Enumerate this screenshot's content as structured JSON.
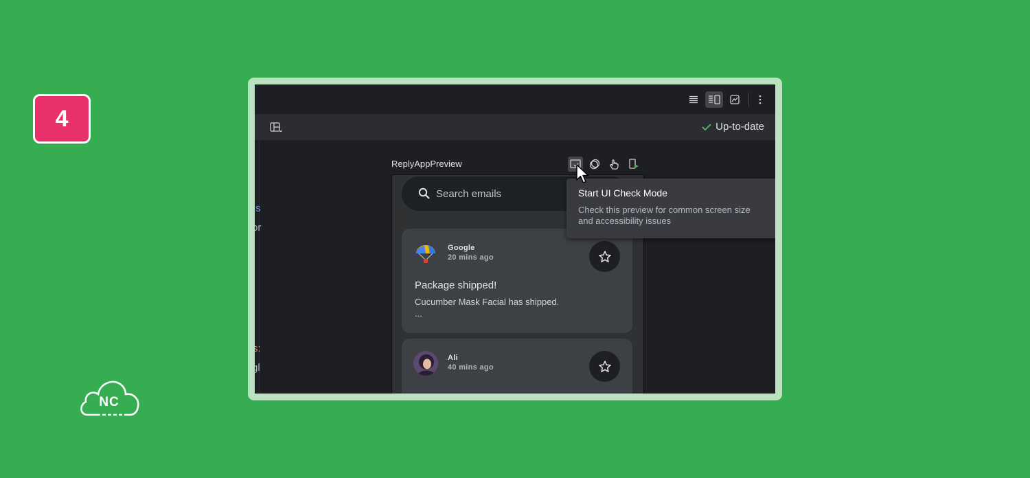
{
  "step": {
    "number": "4"
  },
  "brand": {
    "logo_text": "NC"
  },
  "toolbar": {
    "icons": [
      "code-view-icon",
      "split-view-icon",
      "design-view-icon",
      "more-vertical-icon"
    ]
  },
  "status": {
    "text": "Up-to-date",
    "color": "#59a869"
  },
  "preview": {
    "title": "ReplyAppPreview",
    "search_placeholder": "Search emails",
    "emails": [
      {
        "sender": "Google",
        "time": "20 mins ago",
        "subject": "Package shipped!",
        "body": "Cucumber Mask Facial has shipped.",
        "ellipsis": "..."
      },
      {
        "sender": "Ali",
        "time": "40 mins ago",
        "subject": "",
        "body": "",
        "ellipsis": ""
      }
    ]
  },
  "tooltip": {
    "title": "Start UI Check Mode",
    "description": "Check this preview for common screen size and accessibility issues"
  },
  "colors": {
    "background": "#37ad52",
    "badge": "#e8316a",
    "ide_background": "#1e1f22"
  }
}
